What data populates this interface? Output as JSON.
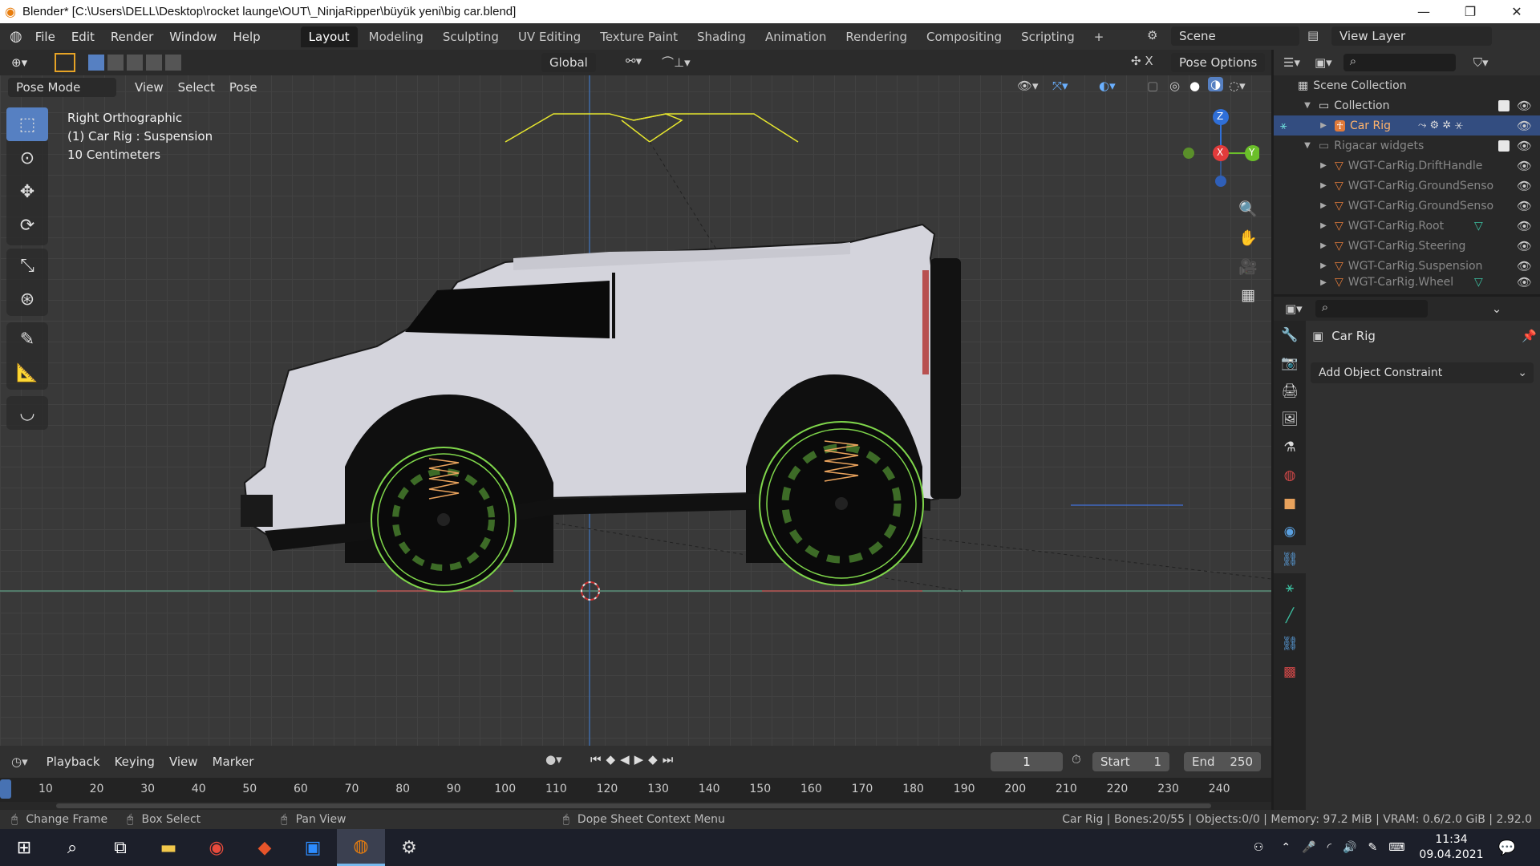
{
  "window": {
    "title": "Blender* [C:\\Users\\DELL\\Desktop\\rocket launge\\OUT\\_NinjaRipper\\büyük yeni\\big car.blend]",
    "minimize": "—",
    "maximize": "❐",
    "close": "✕"
  },
  "menu": [
    "File",
    "Edit",
    "Render",
    "Window",
    "Help"
  ],
  "workspaces": [
    "Layout",
    "Modeling",
    "Sculpting",
    "UV Editing",
    "Texture Paint",
    "Shading",
    "Animation",
    "Rendering",
    "Compositing",
    "Scripting",
    "+"
  ],
  "scene_label": "Scene",
  "view_layer_label": "View Layer",
  "viewport": {
    "mode": "Pose Mode",
    "menus": [
      "View",
      "Select",
      "Pose"
    ],
    "orientation": "Global",
    "pose_options": "Pose Options",
    "info_line1": "Right Orthographic",
    "info_line2": "(1) Car Rig : Suspension",
    "info_line3": "10 Centimeters",
    "axis_z": "Z",
    "axis_y": "Y",
    "axis_x": "X"
  },
  "outliner": {
    "scene_collection": "Scene Collection",
    "collection": "Collection",
    "car_rig": "Car Rig",
    "rigacar_widgets": "Rigacar widgets",
    "widgets": [
      "WGT-CarRig.DriftHandle",
      "WGT-CarRig.GroundSenso",
      "WGT-CarRig.GroundSenso",
      "WGT-CarRig.Root",
      "WGT-CarRig.Steering",
      "WGT-CarRig.Suspension",
      "WGT-CarRig.Wheel"
    ]
  },
  "properties": {
    "object_name": "Car Rig",
    "add_constraint": "Add Object Constraint"
  },
  "timeline": {
    "menus": [
      "Playback",
      "Keying",
      "View",
      "Marker"
    ],
    "current_frame": "1",
    "start_label": "Start",
    "start_value": "1",
    "end_label": "End",
    "end_value": "250",
    "ticks": [
      "10",
      "20",
      "30",
      "40",
      "50",
      "60",
      "70",
      "80",
      "90",
      "100",
      "110",
      "120",
      "130",
      "140",
      "150",
      "160",
      "170",
      "180",
      "190",
      "200",
      "210",
      "220",
      "230",
      "240"
    ]
  },
  "status": {
    "change_frame": "Change Frame",
    "box_select": "Box Select",
    "pan_view": "Pan View",
    "context_menu": "Dope Sheet Context Menu",
    "info": "Car Rig | Bones:20/55 | Objects:0/0 | Memory: 97.2 MiB | VRAM: 0.6/2.0 GiB | 2.92.0"
  },
  "taskbar": {
    "time": "11:34",
    "date": "09.04.2021"
  },
  "colors": {
    "accent": "#5680c2",
    "selected_row": "#334d80",
    "rig_green": "#7fd64b",
    "rig_orange": "#e8a25c",
    "rig_yellow": "#e6e62e"
  }
}
